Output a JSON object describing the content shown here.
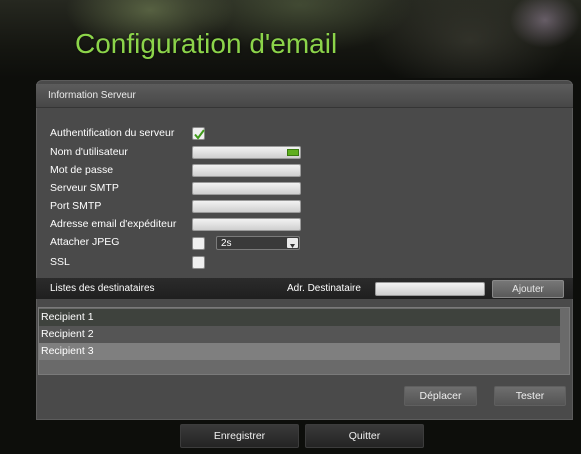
{
  "title": "Configuration d'email",
  "server_section": {
    "title": "Information Serveur",
    "fields": {
      "auth_label": "Authentification du serveur",
      "username_label": "Nom d'utilisateur",
      "username_value": "",
      "password_label": "Mot de passe",
      "smtp_server_label": "Serveur SMTP",
      "smtp_port_label": "Port SMTP",
      "sender_email_label": "Adresse email d'expéditeur",
      "attach_jpeg_label": "Attacher JPEG",
      "attach_interval_value": "2s",
      "ssl_label": "SSL"
    }
  },
  "recipients": {
    "title": "Listes des destinataires",
    "address_label": "Adr. Destinataire",
    "address_value": "",
    "add_button": "Ajouter",
    "items": [
      "Recipient 1",
      "Recipient 2",
      "Recipient 3"
    ]
  },
  "buttons": {
    "move": "Déplacer",
    "test": "Tester",
    "save": "Enregistrer",
    "quit": "Quitter"
  },
  "colors": {
    "title": "#8cd44a",
    "checkbox_checked": "#3f9a1a",
    "keyboard_icon": "#5fae1e",
    "selected_row": "#3e423d"
  },
  "state": {
    "auth_checked": true,
    "attach_jpeg_checked": false,
    "ssl_checked": false,
    "selected_recipient": 1
  }
}
